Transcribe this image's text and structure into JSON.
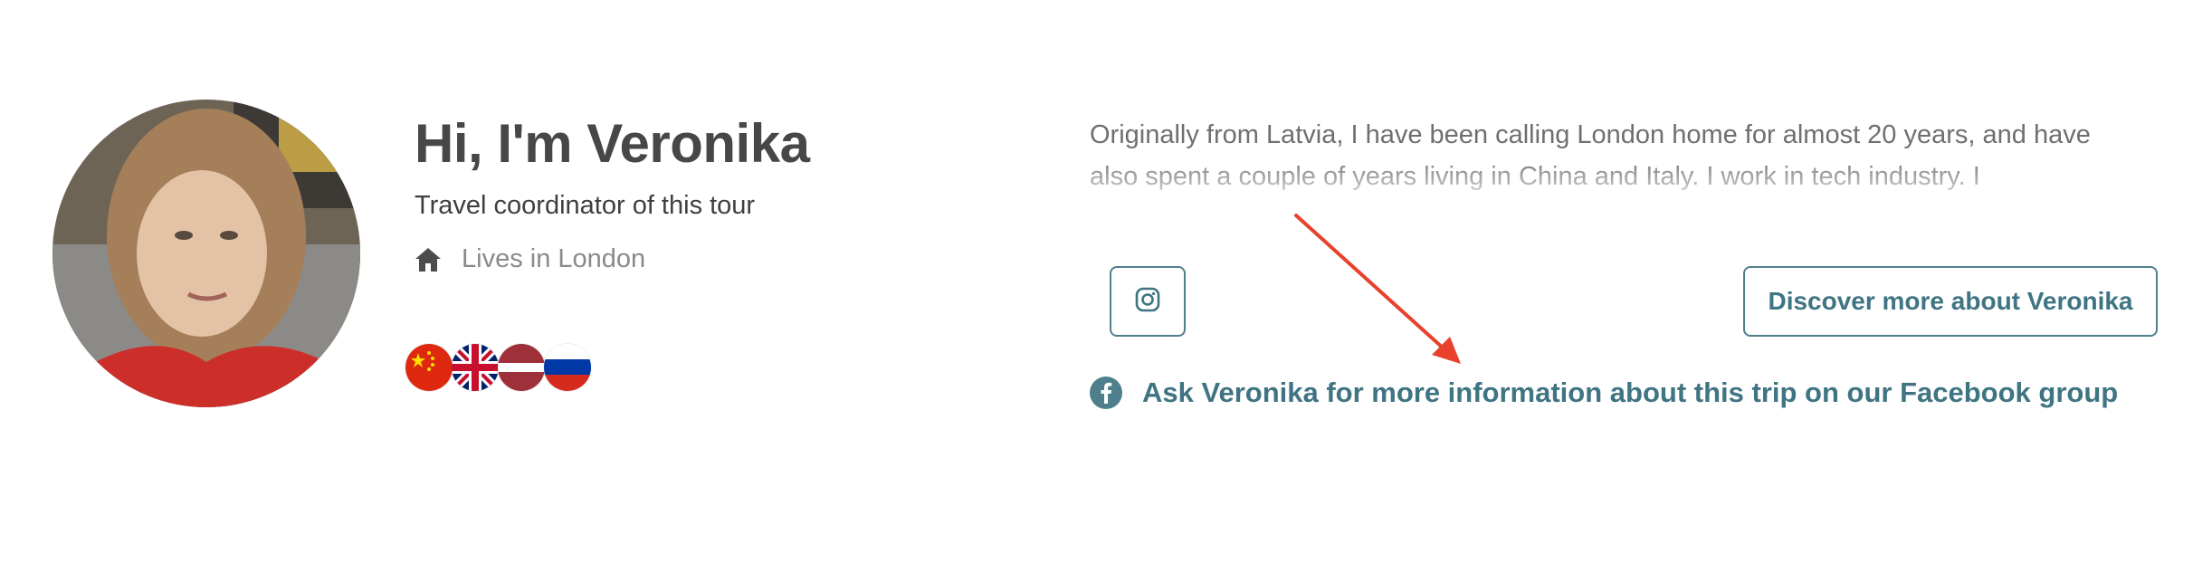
{
  "profile": {
    "title": "Hi, I'm Veronika",
    "subtitle": "Travel coordinator of this tour",
    "location": "Lives in London",
    "avatar_icon": "portrait-photo",
    "languages": [
      {
        "country": "China",
        "icon": "china-flag-icon"
      },
      {
        "country": "United Kingdom",
        "icon": "uk-flag-icon"
      },
      {
        "country": "Latvia",
        "icon": "latvia-flag-icon"
      },
      {
        "country": "Russia",
        "icon": "russia-flag-icon"
      }
    ]
  },
  "bio": {
    "text": "Originally from Latvia, I have been calling London home for almost 20 years, and have also spent a couple of years living in China and Italy. I work in tech industry. I"
  },
  "actions": {
    "instagram_icon": "instagram-icon",
    "discover_label": "Discover more about Veronika",
    "facebook_icon": "facebook-icon",
    "facebook_link": "Ask Veronika for more information about this trip on our Facebook group"
  },
  "colors": {
    "accent": "#3f7482",
    "annotation_arrow": "#e8412c"
  }
}
